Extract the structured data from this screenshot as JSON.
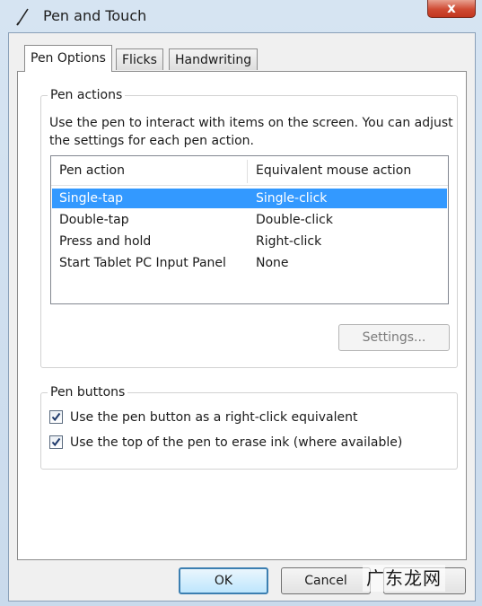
{
  "window": {
    "title": "Pen and Touch",
    "close_label": "x"
  },
  "tabs": [
    {
      "label": "Pen Options",
      "active": true
    },
    {
      "label": "Flicks",
      "active": false
    },
    {
      "label": "Handwriting",
      "active": false
    }
  ],
  "pen_actions": {
    "group_label": "Pen actions",
    "description": "Use the pen to interact with items on the screen.  You can adjust the settings for each pen action.",
    "columns": [
      "Pen action",
      "Equivalent mouse action"
    ],
    "rows": [
      {
        "action": "Single-tap",
        "mouse": "Single-click",
        "selected": true
      },
      {
        "action": "Double-tap",
        "mouse": "Double-click",
        "selected": false
      },
      {
        "action": "Press and hold",
        "mouse": "Right-click",
        "selected": false
      },
      {
        "action": "Start Tablet PC Input Panel",
        "mouse": "None",
        "selected": false
      }
    ],
    "settings_label": "Settings..."
  },
  "pen_buttons": {
    "group_label": "Pen buttons",
    "options": [
      {
        "label": "Use the pen button as a right-click equivalent",
        "checked": true
      },
      {
        "label": "Use the top of the pen to erase ink (where available)",
        "checked": true
      }
    ]
  },
  "buttons": {
    "ok": "OK",
    "cancel": "Cancel"
  },
  "watermark": "广东龙网",
  "colors": {
    "selection": "#3399ff",
    "close": "#c2361f",
    "frame": "#c9daec"
  }
}
